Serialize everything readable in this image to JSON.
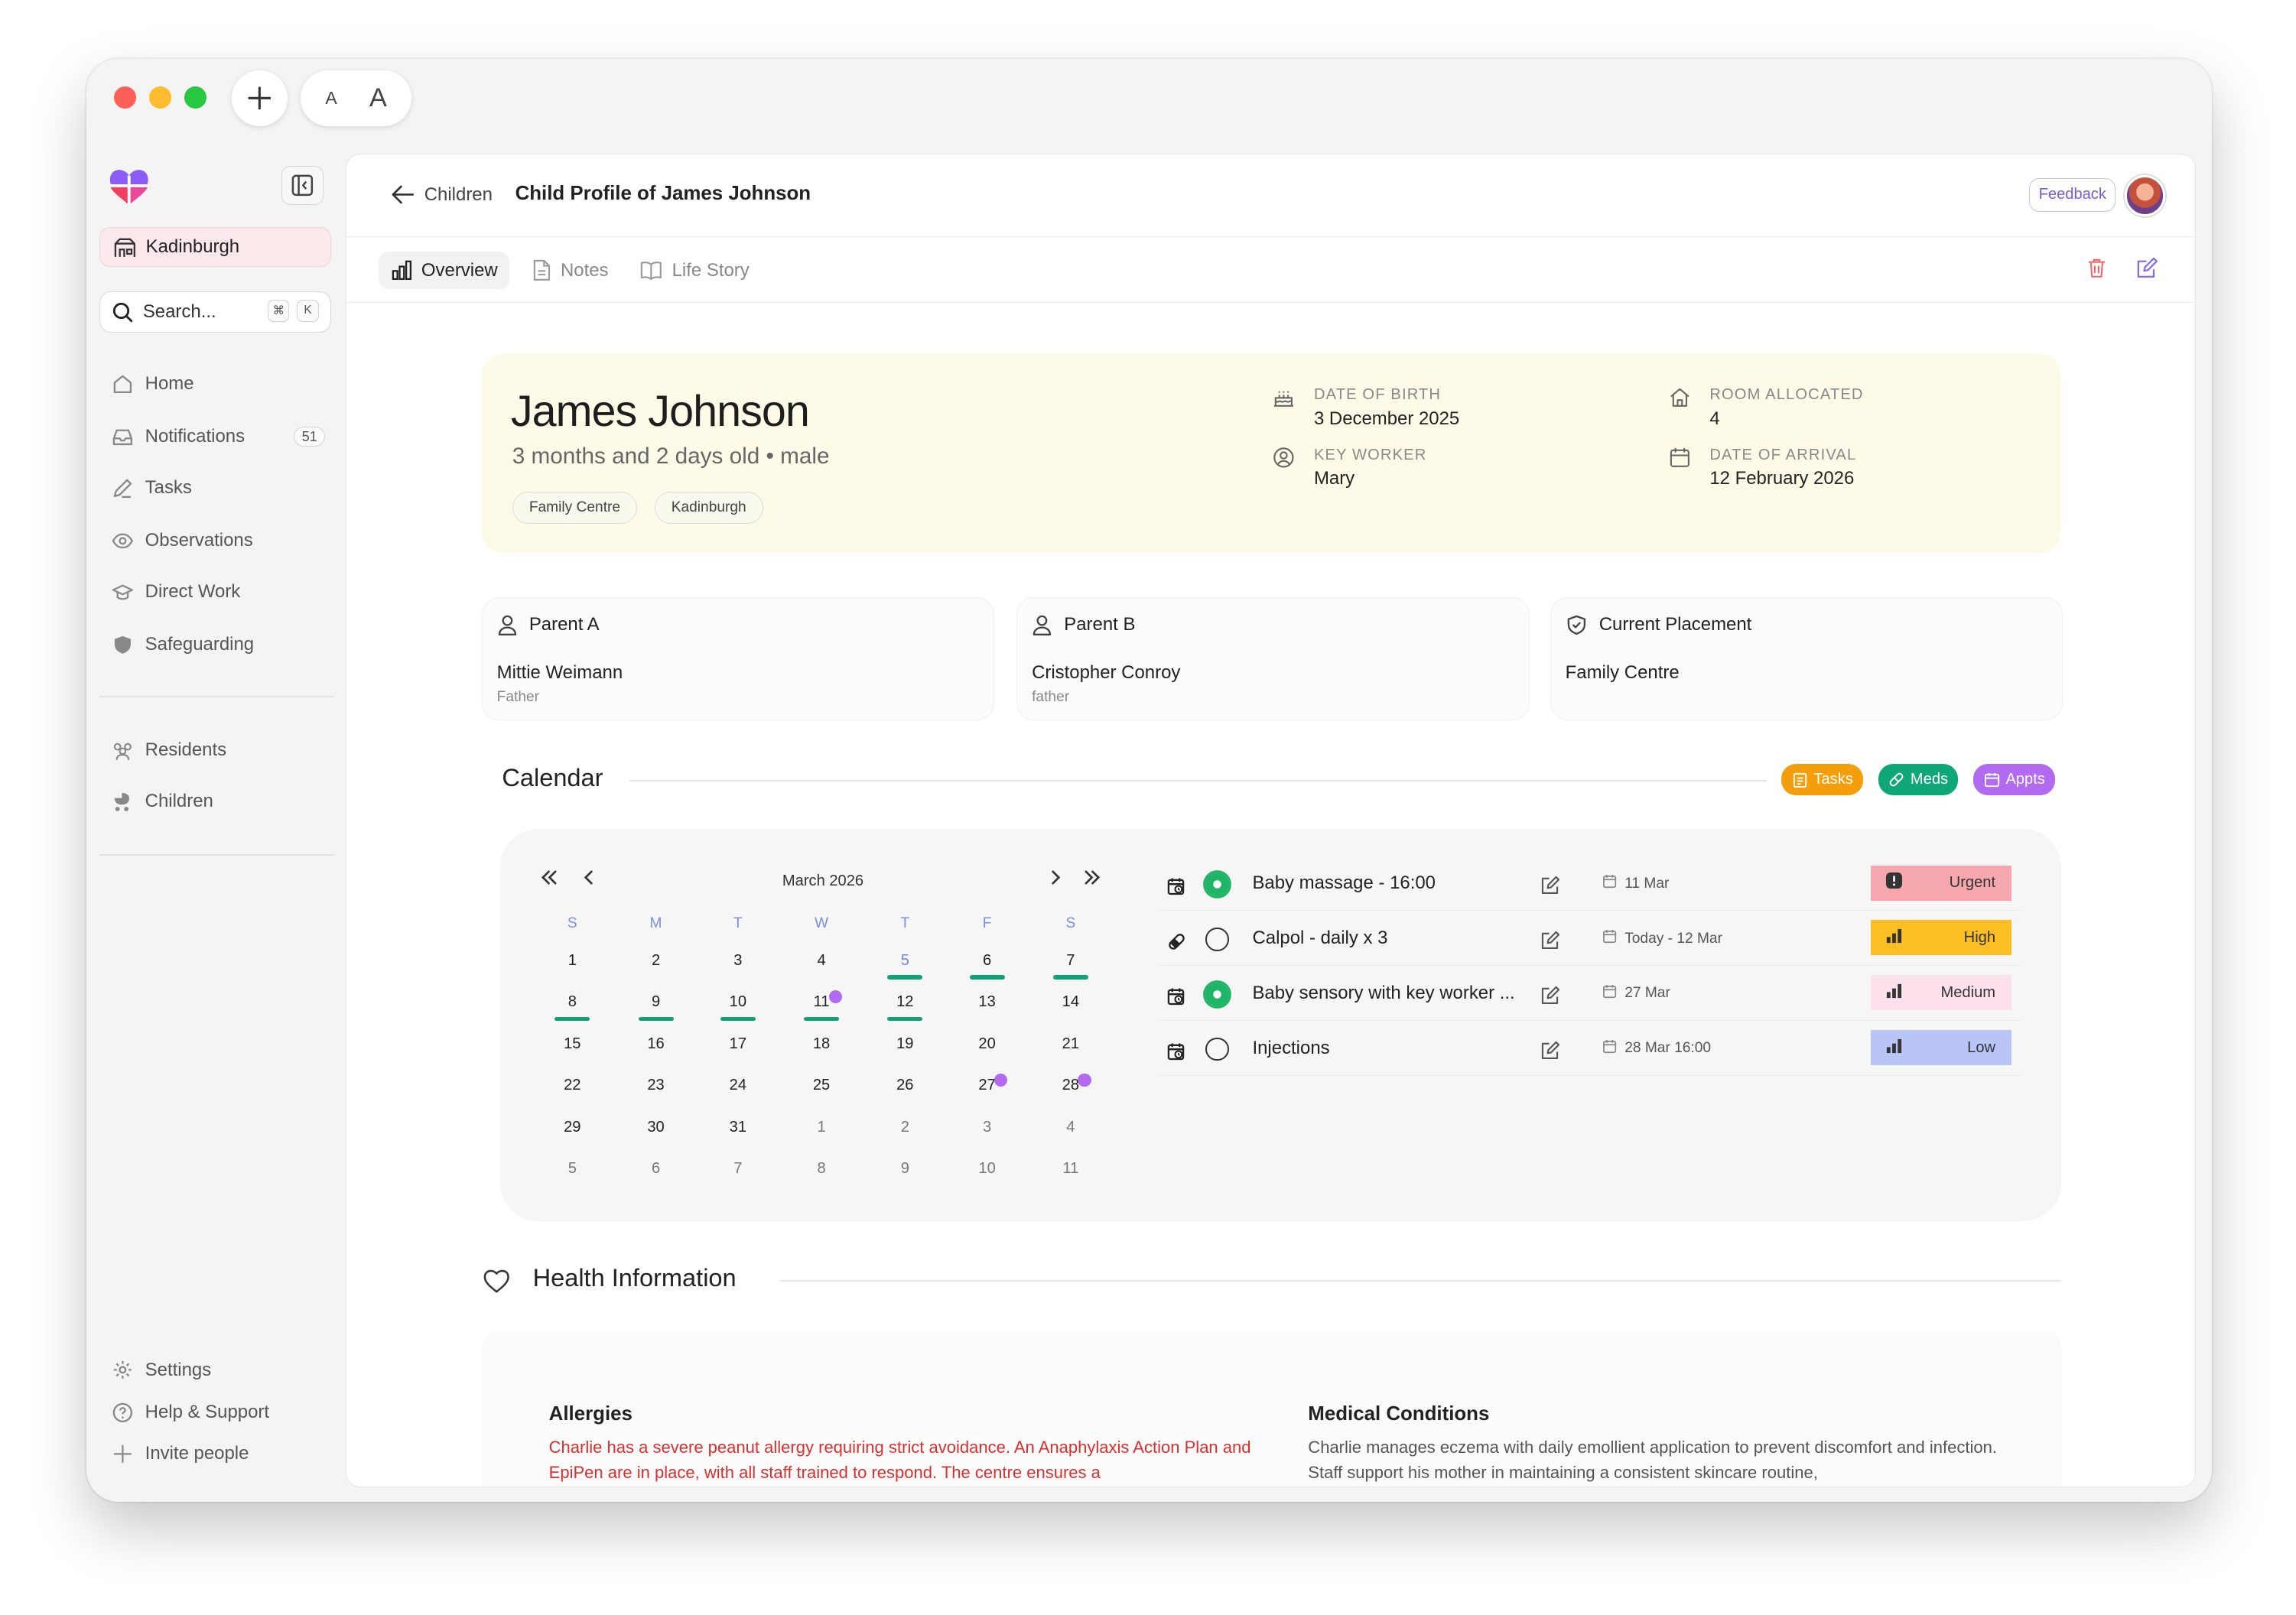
{
  "titlebar": {
    "font_small": "A",
    "font_large": "A"
  },
  "sidebar": {
    "org_name": "Kadinburgh",
    "search_placeholder": "Search...",
    "shortcut_cmd": "⌘",
    "shortcut_key": "K",
    "nav": [
      {
        "label": "Home",
        "icon": "home-icon"
      },
      {
        "label": "Notifications",
        "icon": "inbox-icon",
        "badge": "51"
      },
      {
        "label": "Tasks",
        "icon": "pencil-icon"
      },
      {
        "label": "Observations",
        "icon": "eye-icon"
      },
      {
        "label": "Direct Work",
        "icon": "graduation-cap-icon"
      },
      {
        "label": "Safeguarding",
        "icon": "shield-icon"
      }
    ],
    "nav2": [
      {
        "label": "Residents",
        "icon": "users-icon"
      },
      {
        "label": "Children",
        "icon": "stroller-icon"
      }
    ],
    "footer": [
      {
        "label": "Settings",
        "icon": "gear-icon"
      },
      {
        "label": "Help & Support",
        "icon": "help-icon"
      },
      {
        "label": "Invite people",
        "icon": "plus-icon"
      }
    ]
  },
  "header": {
    "back_label": "Children",
    "title": "Child Profile of James Johnson",
    "feedback_label": "Feedback"
  },
  "tabs": [
    {
      "label": "Overview",
      "active": true
    },
    {
      "label": "Notes",
      "active": false
    },
    {
      "label": "Life Story",
      "active": false
    }
  ],
  "child": {
    "name": "James Johnson",
    "age_line": "3 months and 2 days old • male",
    "tags": [
      "Family Centre",
      "Kadinburgh"
    ],
    "dob_label": "DATE OF BIRTH",
    "dob": "3 December 2025",
    "key_worker_label": "KEY WORKER",
    "key_worker": "Mary",
    "room_label": "ROOM ALLOCATED",
    "room": "4",
    "arrival_label": "DATE OF ARRIVAL",
    "arrival": "12 February 2026"
  },
  "cards": [
    {
      "head": "Parent A",
      "name": "Mittie Weimann",
      "role": "Father"
    },
    {
      "head": "Parent B",
      "name": "Cristopher Conroy",
      "role": "father"
    },
    {
      "head": "Current Placement",
      "name": "Family Centre",
      "role": ""
    }
  ],
  "calendar": {
    "title": "Calendar",
    "legend": [
      {
        "label": "Tasks",
        "color": "#f59e0b"
      },
      {
        "label": "Meds",
        "color": "#10a778"
      },
      {
        "label": "Appts",
        "color": "#b26af0"
      }
    ],
    "month": "March 2026",
    "weekdays": [
      "S",
      "M",
      "T",
      "W",
      "T",
      "F",
      "S"
    ],
    "weeks": [
      [
        {
          "d": "1"
        },
        {
          "d": "2"
        },
        {
          "d": "3"
        },
        {
          "d": "4"
        },
        {
          "d": "5",
          "today": true,
          "bar": true
        },
        {
          "d": "6",
          "bar": true
        },
        {
          "d": "7",
          "bar": true
        }
      ],
      [
        {
          "d": "8",
          "bar": true
        },
        {
          "d": "9",
          "bar": true
        },
        {
          "d": "10",
          "bar": true
        },
        {
          "d": "11",
          "bar": true,
          "dot": true
        },
        {
          "d": "12",
          "bar": true
        },
        {
          "d": "13"
        },
        {
          "d": "14"
        }
      ],
      [
        {
          "d": "15"
        },
        {
          "d": "16"
        },
        {
          "d": "17"
        },
        {
          "d": "18"
        },
        {
          "d": "19"
        },
        {
          "d": "20"
        },
        {
          "d": "21"
        }
      ],
      [
        {
          "d": "22"
        },
        {
          "d": "23"
        },
        {
          "d": "24"
        },
        {
          "d": "25"
        },
        {
          "d": "26"
        },
        {
          "d": "27",
          "dot": true
        },
        {
          "d": "28",
          "dot": true
        }
      ],
      [
        {
          "d": "29"
        },
        {
          "d": "30"
        },
        {
          "d": "31"
        },
        {
          "d": "1",
          "muted": true
        },
        {
          "d": "2",
          "muted": true
        },
        {
          "d": "3",
          "muted": true
        },
        {
          "d": "4",
          "muted": true
        }
      ],
      [
        {
          "d": "5",
          "muted": true
        },
        {
          "d": "6",
          "muted": true
        },
        {
          "d": "7",
          "muted": true
        },
        {
          "d": "8",
          "muted": true
        },
        {
          "d": "9",
          "muted": true
        },
        {
          "d": "10",
          "muted": true
        },
        {
          "d": "11",
          "muted": true
        }
      ]
    ],
    "tasks": [
      {
        "type_icon": "calendar-clock-icon",
        "done": true,
        "title": "Baby massage - 16:00",
        "date": "11 Mar",
        "priority": "Urgent",
        "prio_bg": "#f7a8ae",
        "prio_icon": "alert-icon"
      },
      {
        "type_icon": "pill-icon",
        "done": false,
        "title": "Calpol - daily x 3",
        "date": "Today - 12 Mar",
        "priority": "High",
        "prio_bg": "#fbbf24",
        "prio_icon": "signal-icon"
      },
      {
        "type_icon": "calendar-clock-icon",
        "done": true,
        "title": "Baby sensory with key worker ...",
        "date": "27 Mar",
        "priority": "Medium",
        "prio_bg": "#fde2ee",
        "prio_icon": "signal-icon"
      },
      {
        "type_icon": "calendar-clock-icon",
        "done": false,
        "title": "Injections",
        "date": "28 Mar 16:00",
        "priority": "Low",
        "prio_bg": "#b9c4f7",
        "prio_icon": "signal-icon"
      }
    ]
  },
  "health": {
    "title": "Health Information",
    "allergies_title": "Allergies",
    "allergies_text": "Charlie has a severe peanut allergy requiring strict avoidance. An Anaphylaxis Action Plan and EpiPen are in place, with all staff trained to respond. The centre ensures a",
    "conditions_title": "Medical Conditions",
    "conditions_text": "Charlie manages eczema with daily emollient application to prevent discomfort and infection. Staff support his mother in maintaining a consistent skincare routine,"
  }
}
